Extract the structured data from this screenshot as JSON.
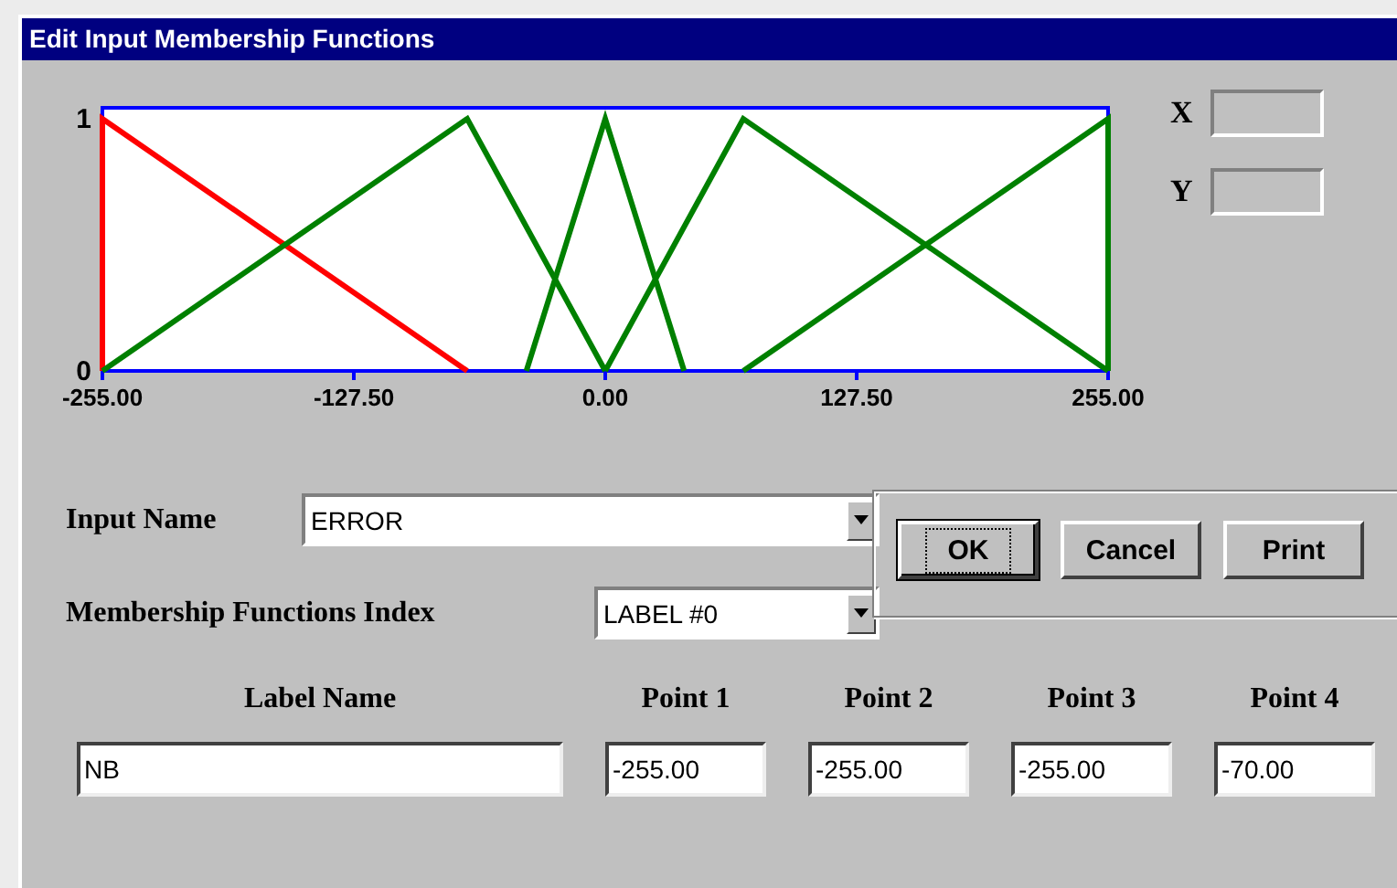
{
  "window": {
    "title": "Edit Input Membership Functions"
  },
  "chart": {
    "chart_data": {
      "type": "line",
      "xlim": [
        -255,
        255
      ],
      "ylim": [
        0,
        1
      ],
      "yticks": [
        0,
        1
      ],
      "xticks": [
        {
          "value": -255,
          "label": "-255.00"
        },
        {
          "value": -127.5,
          "label": "-127.50"
        },
        {
          "value": 0,
          "label": "0.00"
        },
        {
          "value": 127.5,
          "label": "127.50"
        },
        {
          "value": 255,
          "label": "255.00"
        }
      ],
      "series": [
        {
          "color": "#ff0000",
          "x": [
            -255,
            -255,
            -70
          ],
          "values": [
            0,
            1,
            0
          ]
        },
        {
          "color": "#008000",
          "x": [
            -255,
            -70,
            0
          ],
          "values": [
            0,
            1,
            0
          ]
        },
        {
          "color": "#008000",
          "x": [
            -40,
            0,
            40
          ],
          "values": [
            0,
            1,
            0
          ]
        },
        {
          "color": "#008000",
          "x": [
            0,
            70,
            255
          ],
          "values": [
            0,
            1,
            0
          ]
        },
        {
          "color": "#008000",
          "x": [
            70,
            255,
            255
          ],
          "values": [
            0,
            1,
            0
          ]
        }
      ]
    }
  },
  "readouts": [
    {
      "label": "X"
    },
    {
      "label": "Y"
    }
  ],
  "input_name": {
    "label": "Input Name",
    "value": "ERROR"
  },
  "mf_index": {
    "label": "Membership Functions Index",
    "value": "LABEL #0"
  },
  "buttons": [
    {
      "label": "OK",
      "focused": true
    },
    {
      "label": "Cancel",
      "focused": false
    },
    {
      "label": "Print",
      "focused": false
    }
  ],
  "fields": [
    {
      "header": "Label Name",
      "value": "NB"
    },
    {
      "header": "Point 1",
      "value": "-255.00"
    },
    {
      "header": "Point 2",
      "value": "-255.00"
    },
    {
      "header": "Point 3",
      "value": "-255.00"
    },
    {
      "header": "Point 4",
      "value": "-70.00"
    }
  ]
}
